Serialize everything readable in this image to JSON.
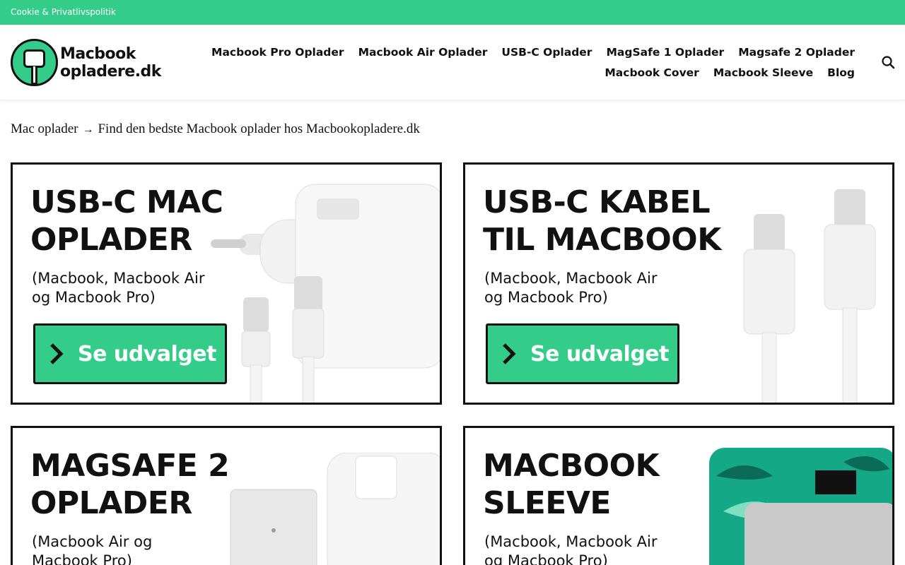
{
  "topbar": {
    "link": "Cookie & Privatlivspolitik"
  },
  "logo": {
    "line1": "Macbook",
    "line2": "opladere.dk"
  },
  "nav": {
    "row1": [
      "Macbook Pro Oplader",
      "Macbook Air Oplader",
      "USB-C Oplader",
      "MagSafe 1 Oplader",
      "Magsafe 2 Oplader"
    ],
    "row2": [
      "Macbook Cover",
      "Macbook Sleeve",
      "Blog"
    ],
    "search_icon": "search-icon"
  },
  "breadcrumb": {
    "home": "Mac oplader",
    "separator": "→",
    "current": "Find den bedste Macbook oplader hos Macbookopladere.dk"
  },
  "cards": [
    {
      "title": [
        "USB-C MAC",
        "OPLADER"
      ],
      "subtitle": [
        "(Macbook, Macbook Air",
        "og Macbook Pro)"
      ],
      "cta": "Se udvalget"
    },
    {
      "title": [
        "USB-C KABEL",
        "TIL MACBOOK"
      ],
      "subtitle": [
        "(Macbook, Macbook Air",
        "og Macbook Pro)"
      ],
      "cta": "Se udvalget"
    },
    {
      "title": [
        "MAGSAFE 2",
        "OPLADER"
      ],
      "subtitle": [
        "(Macbook Air og",
        "Macbook Pro)"
      ]
    },
    {
      "title": [
        "MACBOOK",
        "SLEEVE"
      ],
      "subtitle": [
        "(Macbook, Macbook Air",
        "og Macbook Pro)"
      ]
    }
  ],
  "colors": {
    "accent": "#33cc88",
    "text": "#111111"
  }
}
